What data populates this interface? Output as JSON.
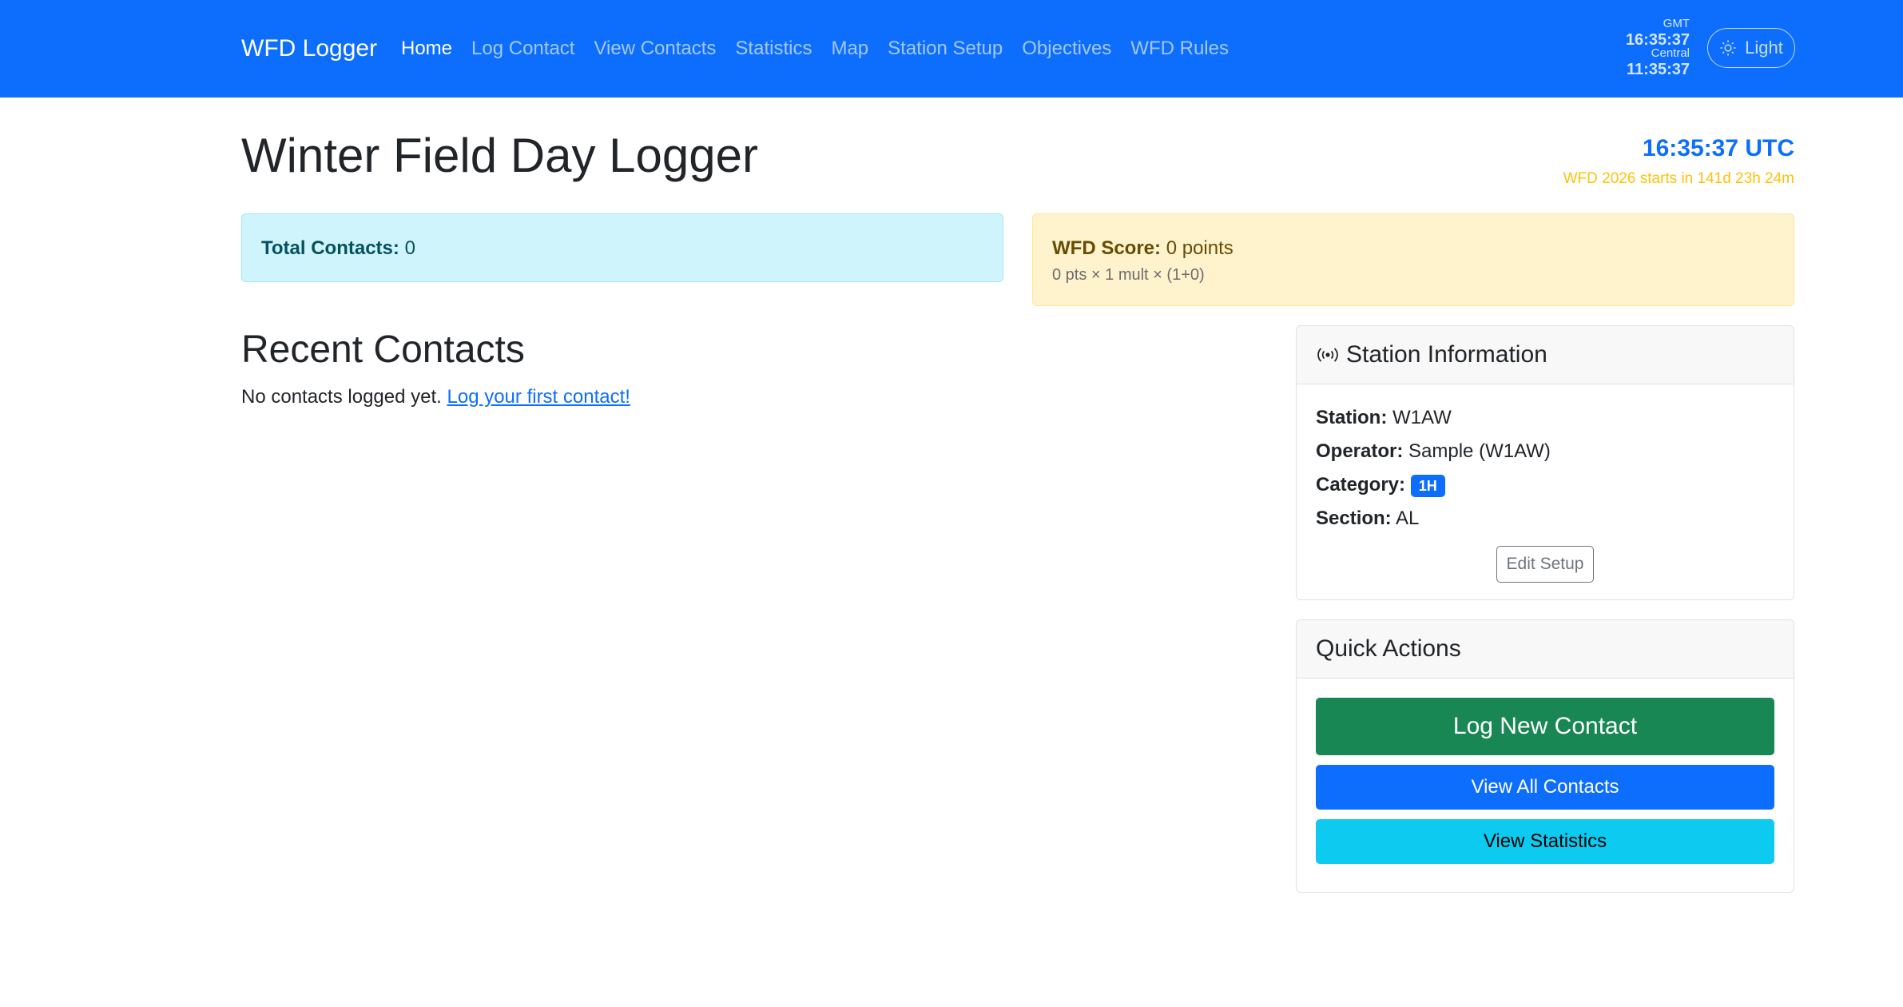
{
  "nav": {
    "brand": "WFD Logger",
    "links": [
      "Home",
      "Log Contact",
      "View Contacts",
      "Statistics",
      "Map",
      "Station Setup",
      "Objectives",
      "WFD Rules"
    ],
    "active_index": 0,
    "clock": {
      "gmt_label": "GMT",
      "gmt_time": "16:35:37",
      "central_label": "Central",
      "central_time": "11:35:37"
    },
    "theme_label": "Light",
    "theme_icon": "sun-icon"
  },
  "header": {
    "title": "Winter Field Day Logger",
    "utc_time": "16:35:37 UTC",
    "countdown": "WFD 2026 starts in 141d 23h 24m"
  },
  "totals": {
    "label": "Total Contacts:",
    "value": "0"
  },
  "score": {
    "label": "WFD Score:",
    "value": "0 points",
    "formula": "0 pts × 1 mult × (1+0)"
  },
  "recent": {
    "title": "Recent Contacts",
    "empty_text": "No contacts logged yet.",
    "link_text": "Log your first contact!"
  },
  "station": {
    "title": "Station Information",
    "icon": "broadcast-icon",
    "station_label": "Station:",
    "station_value": "W1AW",
    "operator_label": "Operator:",
    "operator_value": "Sample (W1AW)",
    "category_label": "Category:",
    "category_value": "1H",
    "section_label": "Section:",
    "section_value": "AL",
    "edit_label": "Edit Setup"
  },
  "actions": {
    "title": "Quick Actions",
    "log_new": "Log New Contact",
    "view_all": "View All Contacts",
    "view_stats": "View Statistics"
  },
  "colors": {
    "primary": "#0d6efd",
    "success": "#198754",
    "info": "#0dcaf0",
    "warning": "#ffc107"
  }
}
